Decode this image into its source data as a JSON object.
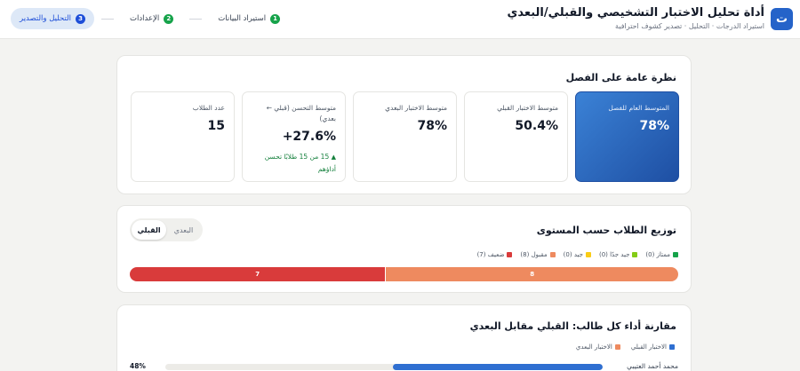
{
  "header": {
    "logo_glyph": "ت",
    "title": "أداة تحليل الاختبار التشخيصي والقبلي/البعدي",
    "subtitle": "استيراد الدرجات · التحليل · تصدير كشوف احترافية",
    "steps": [
      {
        "num": "1",
        "label": "استيراد البيانات",
        "state": "done"
      },
      {
        "num": "2",
        "label": "الإعدادات",
        "state": "done"
      },
      {
        "num": "3",
        "label": "التحليل والتصدير",
        "state": "current"
      }
    ]
  },
  "overview": {
    "title": "نظرة عامة على الفصل",
    "kpis": [
      {
        "label": "المتوسط العام للفصل",
        "value": "78%",
        "highlight": true
      },
      {
        "label": "متوسط الاختبار القبلي",
        "value": "50.4%"
      },
      {
        "label": "متوسط الاختبار البعدي",
        "value": "78%"
      },
      {
        "label": "متوسط التحسن (قبلي ← بعدي)",
        "value": "+27.6%",
        "note": "15 من 15 طلابًا تحسن أداؤهم"
      },
      {
        "label": "عدد الطلاب",
        "value": "15"
      }
    ]
  },
  "distribution": {
    "title": "توزيع الطلاب حسب المستوى",
    "toggle": {
      "pre": "القبلي",
      "post": "البعدي",
      "selected": "pre"
    },
    "legend": [
      {
        "label": "ممتاز (0)",
        "color": "#16a34a"
      },
      {
        "label": "جيد جدًا (0)",
        "color": "#84cc16"
      },
      {
        "label": "جيد (0)",
        "color": "#facc15"
      },
      {
        "label": "مقبول (8)",
        "color": "#ee8a5f"
      },
      {
        "label": "ضعيف (7)",
        "color": "#d93b3b"
      }
    ],
    "segments": [
      {
        "label": "8",
        "value": 8,
        "color": "#ee8a5f"
      },
      {
        "label": "7",
        "value": 7,
        "color": "#d93b3b"
      }
    ]
  },
  "comparison": {
    "title": "مقارنة أداء كل طالب: القبلي مقابل البعدي",
    "legend": [
      {
        "label": "الاختبار القبلي",
        "color": "#2f6fd1"
      },
      {
        "label": "الاختبار البعدي",
        "color": "#ee8a5f"
      }
    ],
    "students": [
      {
        "name": "محمد أحمد العتيبي",
        "pre": 48,
        "value_label": "48%"
      }
    ]
  }
}
